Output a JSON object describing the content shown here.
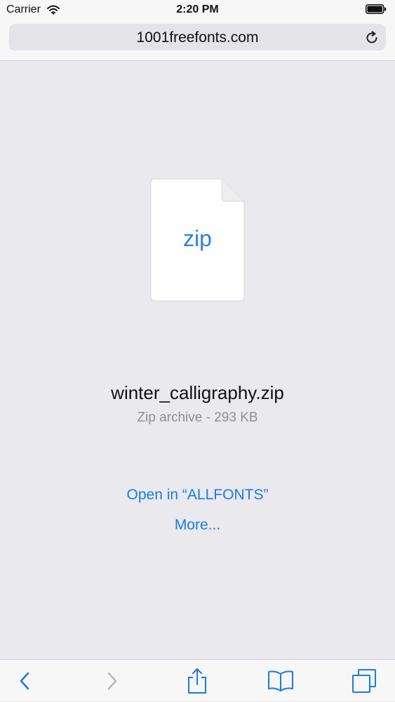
{
  "status_bar": {
    "carrier": "Carrier",
    "time": "2:20 PM"
  },
  "address_bar": {
    "url": "1001freefonts.com"
  },
  "file": {
    "icon_label": "zip",
    "name": "winter_calligraphy.zip",
    "info": "Zip archive - 293 KB"
  },
  "actions": {
    "open_in": "Open in “ALLFONTS”",
    "more": "More..."
  },
  "colors": {
    "accent": "#1a7ce0",
    "background": "#e9e9ee",
    "toolbar": "#f7f7f8",
    "secondary_text": "#8e8e93",
    "disabled_icon": "#b8b8bd"
  },
  "toolbar": {
    "icons": [
      "back-icon",
      "forward-icon",
      "share-icon",
      "bookmarks-icon",
      "tabs-icon"
    ]
  }
}
